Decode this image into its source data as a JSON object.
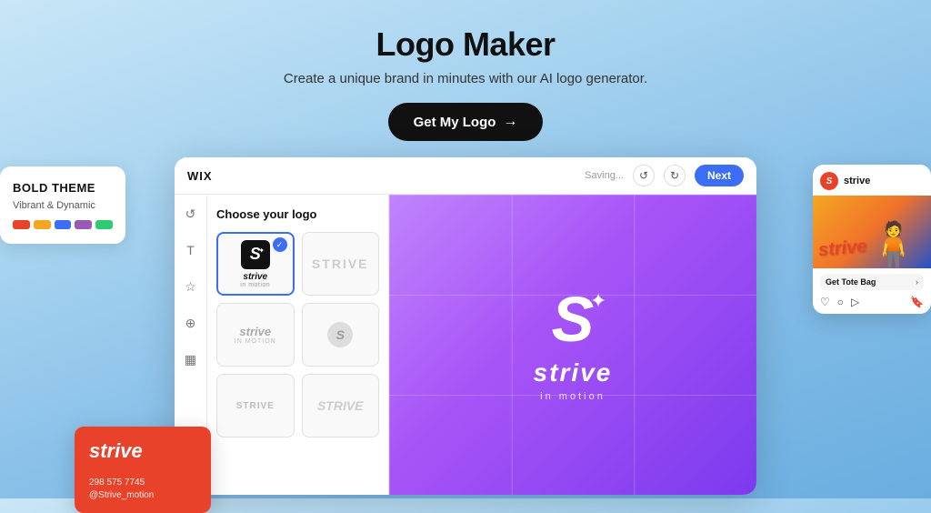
{
  "header": {
    "title": "Logo Maker",
    "subtitle": "Create a unique brand in minutes with our AI logo generator.",
    "cta_label": "Get My Logo",
    "cta_arrow": "→"
  },
  "wix_editor": {
    "logo_text": "WIX",
    "saving_text": "Saving...",
    "next_label": "Next",
    "panel_title": "Choose your logo",
    "canvas_brand": "strive",
    "canvas_tagline": "in motion"
  },
  "bold_theme": {
    "label": "BOLD THEME",
    "subtitle": "Vibrant & Dynamic",
    "swatches": [
      "#e8422a",
      "#f5a623",
      "#3b6ef5",
      "#9b59b6",
      "#2ecc71"
    ]
  },
  "business_card": {
    "brand": "strive",
    "phone": "298 575 7745",
    "handle": "@Strive_motion"
  },
  "social_card": {
    "brand_name": "strive",
    "get_tote": "Get Tote Bag"
  },
  "sidebar_icons": [
    "↺",
    "T",
    "☆",
    "⊕",
    "▦"
  ]
}
